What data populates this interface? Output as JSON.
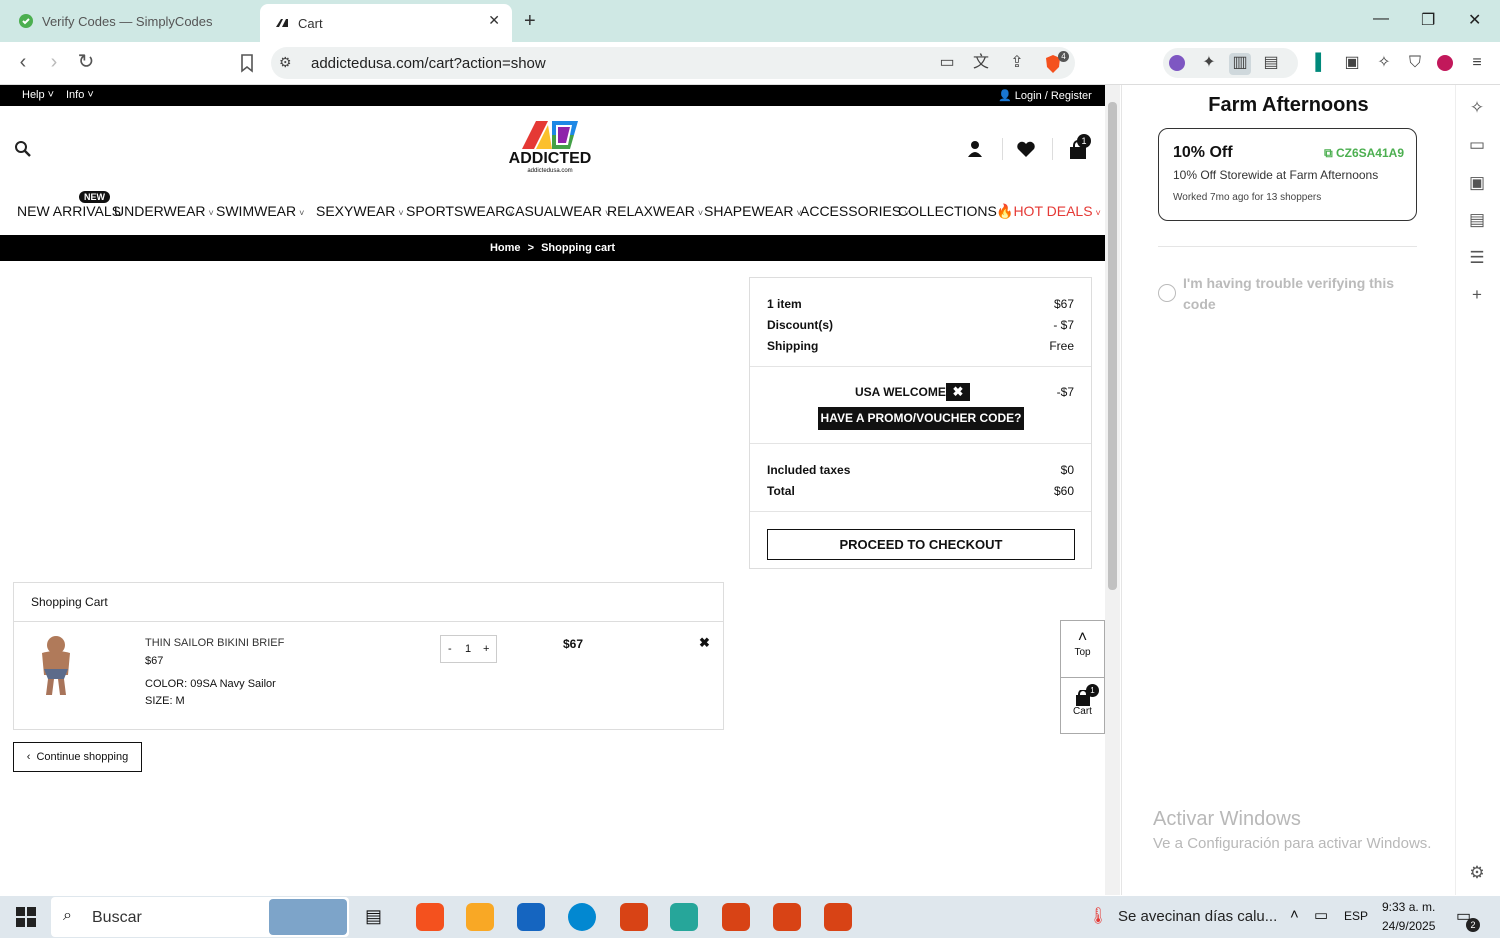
{
  "browser": {
    "tabs": [
      {
        "title": "Verify Codes — SimplyCodes",
        "active": false
      },
      {
        "title": "Cart",
        "active": true
      }
    ],
    "url": "addictedusa.com/cart?action=show",
    "extension_badge": "4"
  },
  "site": {
    "topbar": {
      "help": "Help",
      "info": "Info",
      "login": "Login / Register"
    },
    "logo": {
      "name": "ADDICTED",
      "sub": "addictedusa.com"
    },
    "cart_count": "1",
    "new_badge": "NEW",
    "menu": [
      "NEW ARRIVALS",
      "UNDERWEAR",
      "SWIMWEAR",
      "SEXYWEAR",
      "SPORTSWEAR",
      "CASUALWEAR",
      "RELAXWEAR",
      "SHAPEWEAR",
      "ACCESSORIES",
      "COLLECTIONS",
      "HOT DEALS"
    ],
    "breadcrumb": {
      "home": "Home",
      "sep": ">",
      "current": "Shopping cart"
    },
    "summary": {
      "items_label": "1 item",
      "items_value": "$67",
      "discount_label": "Discount(s)",
      "discount_value": "- $7",
      "shipping_label": "Shipping",
      "shipping_value": "Free",
      "coupon_name": "USA WELCOME",
      "coupon_value": "-$7",
      "promo_button": "HAVE A PROMO/VOUCHER CODE?",
      "taxes_label": "Included taxes",
      "taxes_value": "$0",
      "total_label": "Total",
      "total_value": "$60",
      "checkout_button": "PROCEED TO CHECKOUT"
    },
    "cart": {
      "heading": "Shopping Cart",
      "item": {
        "name": "THIN SAILOR BIKINI BRIEF",
        "price": "$67",
        "color": "COLOR: 09SA Navy Sailor",
        "size": "SIZE: M",
        "qty": "1",
        "line_total": "$67"
      }
    },
    "continue_button": "Continue shopping",
    "float": {
      "top": "Top",
      "cart": "Cart",
      "cart_count": "1"
    }
  },
  "sidepanel": {
    "store": "Farm Afternoons",
    "offer_title": "10% Off",
    "code": "CZ6SA41A9",
    "offer_desc": "10% Off Storewide at Farm Afternoons",
    "worked": "Worked 7mo ago for 13 shoppers",
    "trouble": "I'm having trouble verifying this code",
    "watermark_title": "Activar Windows",
    "watermark_sub": "Ve a Configuración para activar Windows."
  },
  "taskbar": {
    "search": "Buscar",
    "weather": "Se avecinan días calu...",
    "lang": "ESP",
    "time": "9:33 a. m.",
    "date": "24/9/2025",
    "notif": "2"
  },
  "colors": {
    "accent_green": "#4caf50",
    "hot_deals": "#e53935",
    "tab_bar": "#cfe8e4"
  }
}
